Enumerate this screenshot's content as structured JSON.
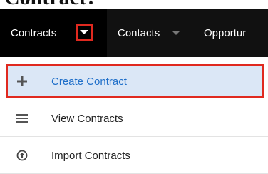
{
  "page_heading": "Contract?",
  "nav": {
    "tabs": [
      {
        "label": "Contracts",
        "active": true
      },
      {
        "label": "Contacts",
        "active": false
      },
      {
        "label": "Opportur",
        "active": false
      }
    ]
  },
  "menu": {
    "items": [
      {
        "label": "Create Contract",
        "icon": "plus-icon",
        "highlighted": true
      },
      {
        "label": "View Contracts",
        "icon": "list-icon",
        "highlighted": false
      },
      {
        "label": "Import Contracts",
        "icon": "import-icon",
        "highlighted": false
      }
    ]
  },
  "colors": {
    "navbar_bg": "#111111",
    "active_tab_bg": "#000000",
    "highlight_border": "#e0291f",
    "highlight_bg": "#dbe7f6",
    "link_blue": "#1f6fc9"
  }
}
